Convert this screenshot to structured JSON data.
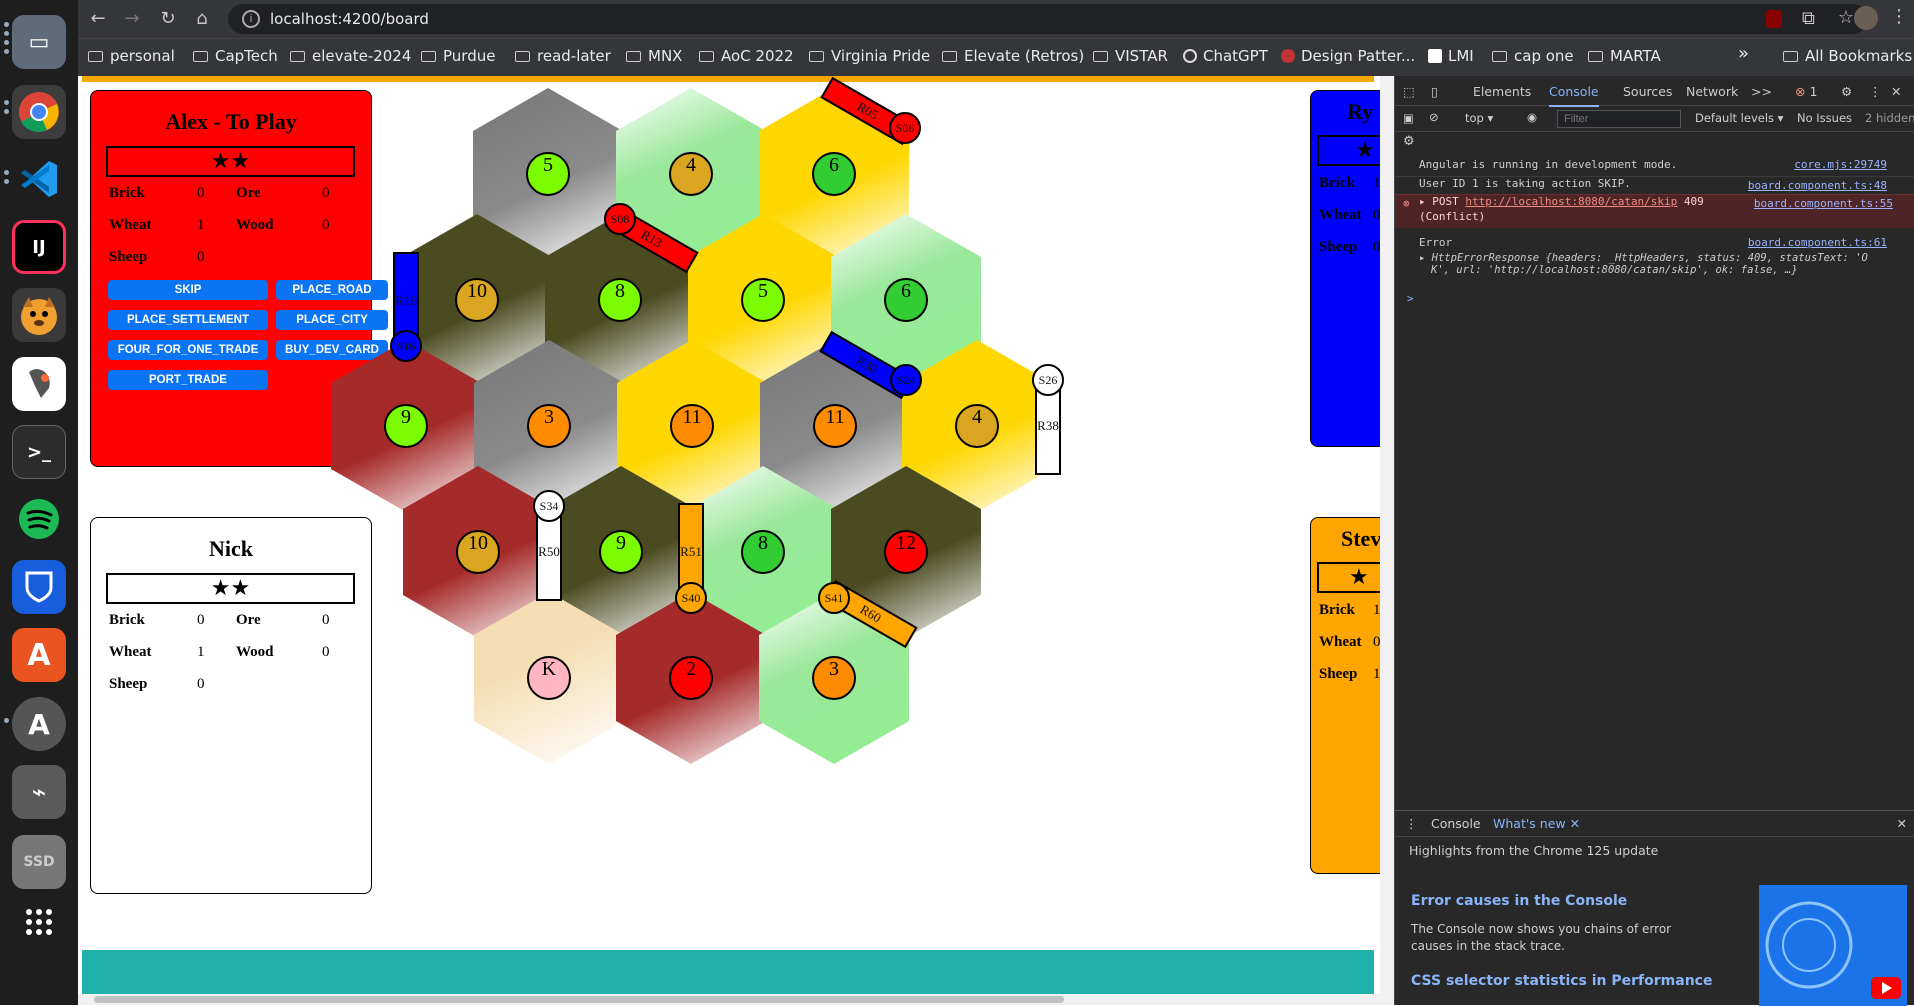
{
  "dock": {
    "apps": [
      "files",
      "chrome",
      "vscode",
      "intellij",
      "dog-app",
      "postman",
      "terminal",
      "spotify",
      "bitwarden",
      "app-store",
      "updater",
      "usb",
      "ssd",
      "app-grid"
    ],
    "ij_label": "IJ",
    "ssd_label": "SSD",
    "terminal_label": ">_"
  },
  "browser": {
    "url": "localhost:4200/board",
    "bookmarks": [
      "personal",
      "CapTech",
      "elevate-2024",
      "Purdue",
      "read-later",
      "MNX",
      "AoC 2022",
      "Virginia Pride",
      "Elevate (Retros)",
      "VISTAR",
      "ChatGPT",
      "Design Patter...",
      "LMI",
      "cap one",
      "MARTA"
    ],
    "bookmarks_more": "»",
    "all_bookmarks": "All Bookmarks"
  },
  "players": {
    "current": {
      "title": "Alex - To Play",
      "stars": "★★",
      "resources": {
        "brick_label": "Brick",
        "brick": "0",
        "ore_label": "Ore",
        "ore": "0",
        "wheat_label": "Wheat",
        "wheat": "1",
        "wood_label": "Wood",
        "wood": "0",
        "sheep_label": "Sheep",
        "sheep": "0"
      },
      "actions": {
        "skip": "SKIP",
        "place_road": "PLACE_ROAD",
        "place_settlement": "PLACE_SETTLEMENT",
        "place_city": "PLACE_CITY",
        "four_for_one": "FOUR_FOR_ONE_TRADE",
        "buy_dev_card": "BUY_DEV_CARD",
        "port_trade": "PORT_TRADE"
      },
      "color": "#ff0000"
    },
    "nick": {
      "title": "Nick",
      "stars": "★★",
      "resources": {
        "brick_label": "Brick",
        "brick": "0",
        "ore_label": "Ore",
        "ore": "0",
        "wheat_label": "Wheat",
        "wheat": "1",
        "wood_label": "Wood",
        "wood": "0",
        "sheep_label": "Sheep",
        "sheep": "0"
      }
    },
    "ryan": {
      "title": "Ry",
      "stars": "★",
      "brick_label": "Brick",
      "brick": "1",
      "wheat_label": "Wheat",
      "wheat": "0",
      "sheep_label": "Sheep",
      "sheep": "0",
      "color": "#0000ff"
    },
    "steve": {
      "title": "Stev",
      "stars": "★",
      "brick_label": "Brick",
      "brick": "1",
      "wheat_label": "Wheat",
      "wheat": "0",
      "sheep_label": "Sheep",
      "sheep": "1",
      "color": "#ffa500"
    }
  },
  "board": {
    "tiles": [
      {
        "type": "ore",
        "token": "5",
        "token_color": "#7cfc00"
      },
      {
        "type": "sheep",
        "token": "4",
        "token_color": "#daa520"
      },
      {
        "type": "wheat",
        "token": "6",
        "token_color": "#32cd32"
      },
      {
        "type": "wood",
        "token": "10",
        "token_color": "#daa520"
      },
      {
        "type": "wood",
        "token": "8",
        "token_color": "#7cfc00"
      },
      {
        "type": "wheat",
        "token": "5",
        "token_color": "#7cfc00"
      },
      {
        "type": "sheep",
        "token": "6",
        "token_color": "#32cd32"
      },
      {
        "type": "brick",
        "token": "9",
        "token_color": "#7cfc00"
      },
      {
        "type": "ore",
        "token": "3",
        "token_color": "#ff8c00"
      },
      {
        "type": "wheat",
        "token": "11",
        "token_color": "#ff8c00"
      },
      {
        "type": "ore",
        "token": "11",
        "token_color": "#ff8c00"
      },
      {
        "type": "wheat",
        "token": "4",
        "token_color": "#daa520"
      },
      {
        "type": "brick",
        "token": "10",
        "token_color": "#daa520"
      },
      {
        "type": "wood",
        "token": "9",
        "token_color": "#7cfc00"
      },
      {
        "type": "sheep",
        "token": "8",
        "token_color": "#32cd32"
      },
      {
        "type": "wood",
        "token": "12",
        "token_color": "#ff0000"
      },
      {
        "type": "desert",
        "token": "K",
        "token_color": "#ffb6c1"
      },
      {
        "type": "brick",
        "token": "2",
        "token_color": "#ff0000"
      },
      {
        "type": "sheep",
        "token": "3",
        "token_color": "#ff8c00"
      }
    ],
    "roads": {
      "r05": "R05",
      "r13": "R13",
      "r16": "R16",
      "r30": "R30",
      "r38": "R38",
      "r50": "R50",
      "r51": "R51",
      "r60": "R60"
    },
    "settlements": {
      "s06": "S06",
      "s08": "S08",
      "s16": "S16",
      "s24": "S24",
      "s26": "S26",
      "s34": "S34",
      "s40": "S40",
      "s41": "S41"
    }
  },
  "devtools": {
    "tabs": [
      "Elements",
      "Console",
      "Sources",
      "Network"
    ],
    "more": ">>",
    "error_count": "1",
    "context": "top",
    "filter_placeholder": "Filter",
    "levels": "Default levels",
    "issues": "No Issues",
    "hidden": "2 hidden",
    "logs": [
      {
        "text": "Angular is running in development mode.",
        "source": "core.mjs:29749"
      },
      {
        "text": "User ID 1 is taking action SKIP.",
        "source": "board.component.ts:48"
      },
      {
        "text": "POST",
        "url": "http://localhost:8080/catan/skip",
        "code": "409",
        "status": "(Conflict)",
        "source": "board.component.ts:55"
      },
      {
        "text": "Error",
        "source": "board.component.ts:61"
      },
      {
        "text": "HttpErrorResponse {headers: _HttpHeaders, status: 409, statusText: 'O",
        "text2": "K', url: 'http://localhost:8080/catan/skip', ok: false, …}"
      }
    ],
    "prompt": ">",
    "drawer": {
      "tabs": [
        "Console",
        "What's new"
      ],
      "highlights": "Highlights from the Chrome 125 update",
      "item1_title": "Error causes in the Console",
      "item1_body": "The Console now shows you chains of error causes in the stack trace.",
      "item2_title": "CSS selector statistics in Performance"
    }
  }
}
